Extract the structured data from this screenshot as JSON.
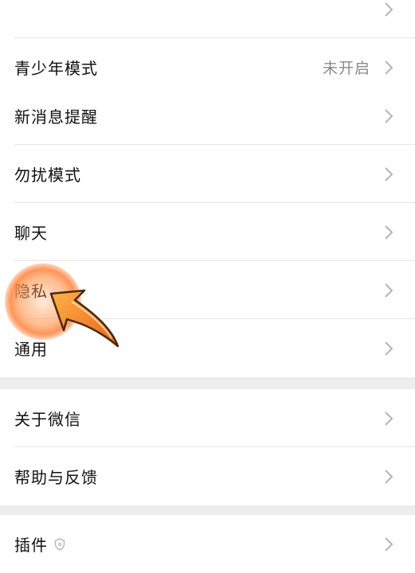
{
  "groups": [
    {
      "rows": [
        {
          "label": "",
          "chevron": true
        },
        {
          "label": "青少年模式",
          "value": "未开启",
          "chevron": true
        }
      ]
    },
    {
      "rows": [
        {
          "label": "新消息提醒",
          "chevron": true
        },
        {
          "label": "勿扰模式",
          "chevron": true
        },
        {
          "label": "聊天",
          "chevron": true
        },
        {
          "label": "隐私",
          "chevron": true
        },
        {
          "label": "通用",
          "chevron": true
        }
      ]
    },
    {
      "rows": [
        {
          "label": "关于微信",
          "chevron": true
        },
        {
          "label": "帮助与反馈",
          "chevron": true
        }
      ]
    },
    {
      "rows": [
        {
          "label": "插件",
          "badge_icon": "shield-icon",
          "chevron": true
        }
      ]
    }
  ],
  "colors": {
    "background": "#ededed",
    "row_background": "#ffffff",
    "secondary_text": "#8a8a8a",
    "highlight": "#ff8a3d"
  },
  "icons": {
    "chevron": "chevron-right-icon",
    "tap_indicator": "tap-arrow-icon"
  }
}
